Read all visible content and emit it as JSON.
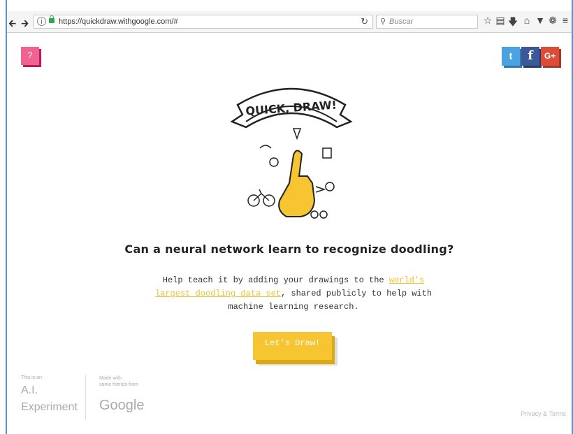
{
  "browser": {
    "url": "https://quickdraw.withgoogle.com/#",
    "search_placeholder": "Buscar",
    "icons": [
      "back-arrow-icon",
      "forward-arrow-icon",
      "info-icon",
      "lock-icon",
      "reload-icon",
      "search-icon",
      "star-icon",
      "reading-list-icon",
      "download-icon",
      "home-icon",
      "pocket-icon",
      "screenshot-icon",
      "menu-icon"
    ]
  },
  "page": {
    "help_label": "?",
    "social": {
      "twitter": "t",
      "facebook": "f",
      "googleplus": "G+"
    },
    "logo_text": "QUICK, DRAW!",
    "headline": "Can a neural network learn to recognize doodling?",
    "desc_before": "Help teach it by adding your drawings to the ",
    "desc_link": "world's largest doodling data set",
    "desc_after": ", shared publicly to help with machine learning research.",
    "cta": "Let's Draw!",
    "footer_exp_small": "This is an",
    "footer_exp_line1": "A.I.",
    "footer_exp_line2": "Experiment",
    "footer_made_small1": "Made with",
    "footer_made_small2": "some friends from",
    "footer_google": "Google",
    "privacy": "Privacy & Terms"
  },
  "colors": {
    "accent_yellow": "#f7c531",
    "help_pink": "#f06292",
    "twitter": "#4aa3df",
    "facebook": "#3b5998",
    "googleplus": "#dd4b39"
  }
}
